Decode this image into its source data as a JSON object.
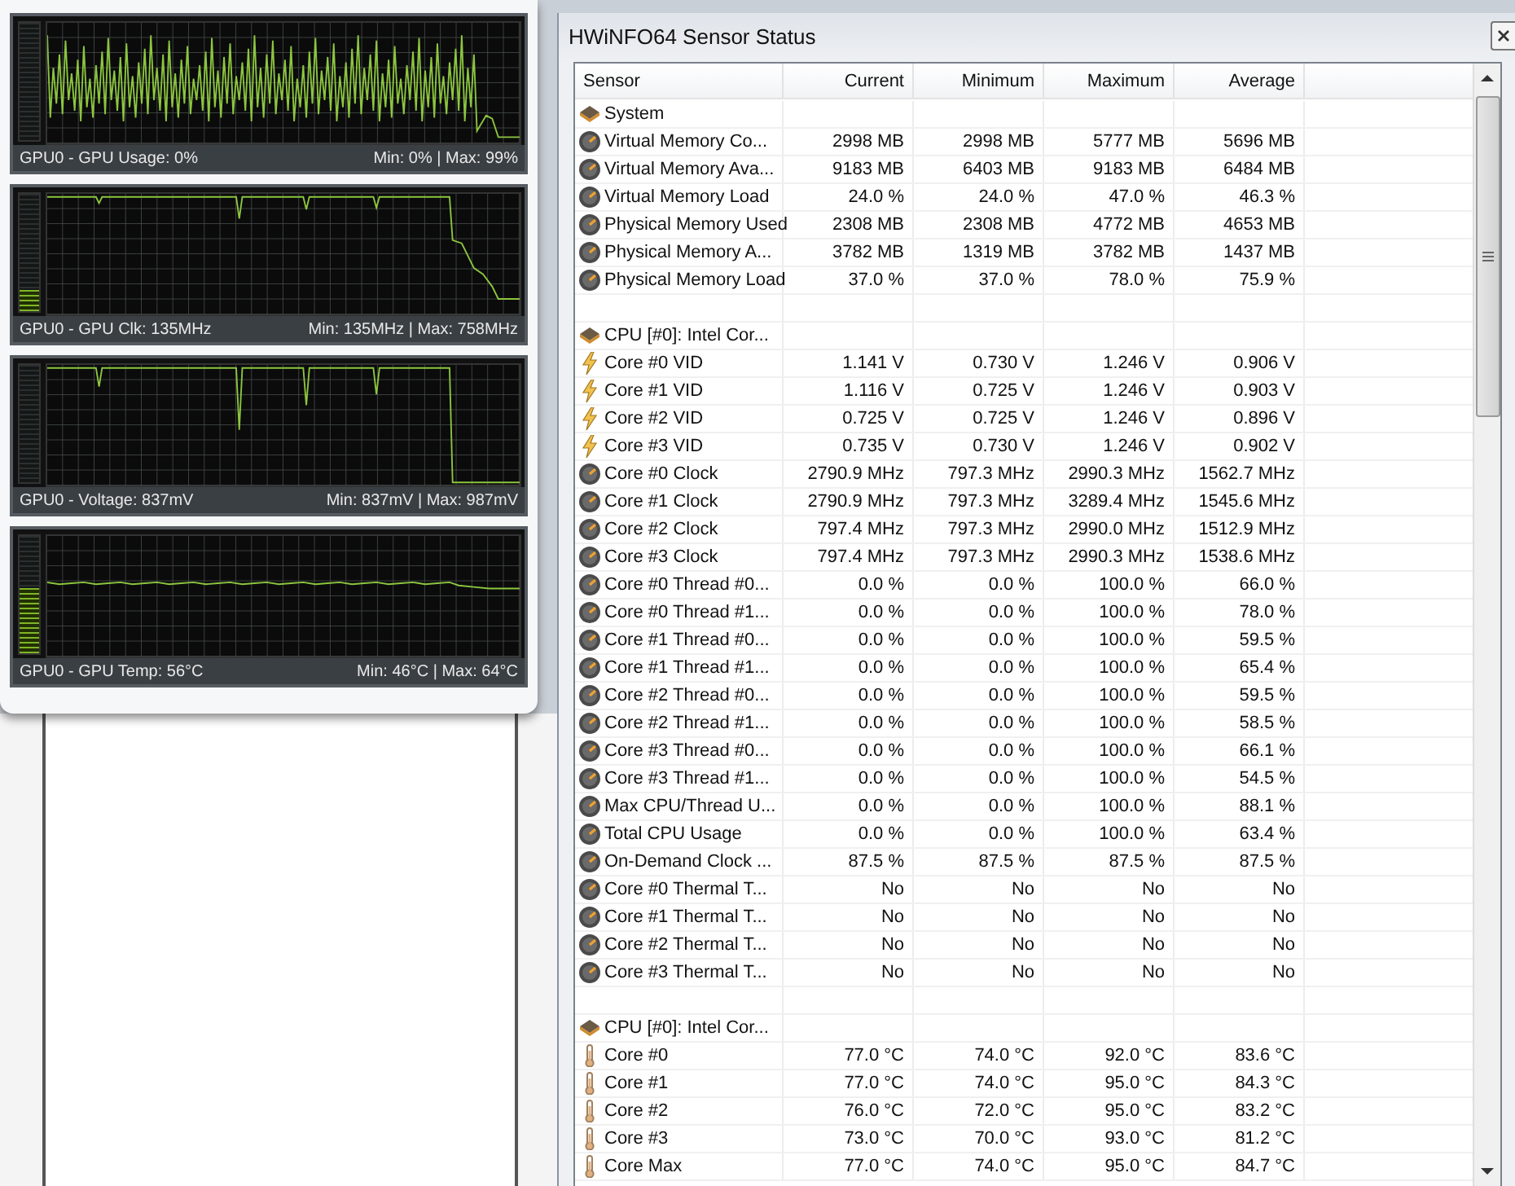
{
  "gadget": {
    "graphs": [
      {
        "kind": "usage",
        "level": 0,
        "label": "GPU0 - GPU Usage: 0%",
        "range": "Min: 0% | Max: 99%"
      },
      {
        "kind": "clock",
        "level": 0.18,
        "label": "GPU0 - GPU Clk: 135MHz",
        "range": "Min: 135MHz | Max: 758MHz"
      },
      {
        "kind": "voltage",
        "level": 0,
        "label": "GPU0 - Voltage: 837mV",
        "range": "Min: 837mV | Max: 987mV"
      },
      {
        "kind": "temp",
        "level": 0.55,
        "label": "GPU0 - GPU Temp: 56°C",
        "range": "Min: 46°C | Max: 64°C"
      }
    ]
  },
  "window": {
    "title": "HWiNFO64 Sensor Status"
  },
  "table": {
    "columns": [
      "Sensor",
      "Current",
      "Minimum",
      "Maximum",
      "Average"
    ],
    "rows": [
      {
        "kind": "group",
        "sensor": "System"
      },
      {
        "kind": "gauge",
        "sensor": "Virtual Memory Co...",
        "current": "2998 MB",
        "minimum": "2998 MB",
        "maximum": "5777 MB",
        "average": "5696 MB"
      },
      {
        "kind": "gauge",
        "sensor": "Virtual Memory Ava...",
        "current": "9183 MB",
        "minimum": "6403 MB",
        "maximum": "9183 MB",
        "average": "6484 MB"
      },
      {
        "kind": "gauge",
        "sensor": "Virtual Memory Load",
        "current": "24.0 %",
        "minimum": "24.0 %",
        "maximum": "47.0 %",
        "average": "46.3 %"
      },
      {
        "kind": "gauge",
        "sensor": "Physical Memory Used",
        "current": "2308 MB",
        "minimum": "2308 MB",
        "maximum": "4772 MB",
        "average": "4653 MB"
      },
      {
        "kind": "gauge",
        "sensor": "Physical Memory A...",
        "current": "3782 MB",
        "minimum": "1319 MB",
        "maximum": "3782 MB",
        "average": "1437 MB"
      },
      {
        "kind": "gauge",
        "sensor": "Physical Memory Load",
        "current": "37.0 %",
        "minimum": "37.0 %",
        "maximum": "78.0 %",
        "average": "75.9 %"
      },
      {
        "kind": "blank"
      },
      {
        "kind": "group",
        "sensor": "CPU [#0]: Intel Cor..."
      },
      {
        "kind": "voltage",
        "sensor": "Core #0 VID",
        "current": "1.141 V",
        "minimum": "0.730 V",
        "maximum": "1.246 V",
        "average": "0.906 V"
      },
      {
        "kind": "voltage",
        "sensor": "Core #1 VID",
        "current": "1.116 V",
        "minimum": "0.725 V",
        "maximum": "1.246 V",
        "average": "0.903 V"
      },
      {
        "kind": "voltage",
        "sensor": "Core #2 VID",
        "current": "0.725 V",
        "minimum": "0.725 V",
        "maximum": "1.246 V",
        "average": "0.896 V"
      },
      {
        "kind": "voltage",
        "sensor": "Core #3 VID",
        "current": "0.735 V",
        "minimum": "0.730 V",
        "maximum": "1.246 V",
        "average": "0.902 V"
      },
      {
        "kind": "gauge",
        "sensor": "Core #0 Clock",
        "current": "2790.9 MHz",
        "minimum": "797.3 MHz",
        "maximum": "2990.3 MHz",
        "average": "1562.7 MHz"
      },
      {
        "kind": "gauge",
        "sensor": "Core #1 Clock",
        "current": "2790.9 MHz",
        "minimum": "797.3 MHz",
        "maximum": "3289.4 MHz",
        "average": "1545.6 MHz"
      },
      {
        "kind": "gauge",
        "sensor": "Core #2 Clock",
        "current": "797.4 MHz",
        "minimum": "797.3 MHz",
        "maximum": "2990.0 MHz",
        "average": "1512.9 MHz"
      },
      {
        "kind": "gauge",
        "sensor": "Core #3 Clock",
        "current": "797.4 MHz",
        "minimum": "797.3 MHz",
        "maximum": "2990.3 MHz",
        "average": "1538.6 MHz"
      },
      {
        "kind": "gauge",
        "sensor": "Core #0 Thread #0...",
        "current": "0.0 %",
        "minimum": "0.0 %",
        "maximum": "100.0 %",
        "average": "66.0 %"
      },
      {
        "kind": "gauge",
        "sensor": "Core #0 Thread #1...",
        "current": "0.0 %",
        "minimum": "0.0 %",
        "maximum": "100.0 %",
        "average": "78.0 %"
      },
      {
        "kind": "gauge",
        "sensor": "Core #1 Thread #0...",
        "current": "0.0 %",
        "minimum": "0.0 %",
        "maximum": "100.0 %",
        "average": "59.5 %"
      },
      {
        "kind": "gauge",
        "sensor": "Core #1 Thread #1...",
        "current": "0.0 %",
        "minimum": "0.0 %",
        "maximum": "100.0 %",
        "average": "65.4 %"
      },
      {
        "kind": "gauge",
        "sensor": "Core #2 Thread #0...",
        "current": "0.0 %",
        "minimum": "0.0 %",
        "maximum": "100.0 %",
        "average": "59.5 %"
      },
      {
        "kind": "gauge",
        "sensor": "Core #2 Thread #1...",
        "current": "0.0 %",
        "minimum": "0.0 %",
        "maximum": "100.0 %",
        "average": "58.5 %"
      },
      {
        "kind": "gauge",
        "sensor": "Core #3 Thread #0...",
        "current": "0.0 %",
        "minimum": "0.0 %",
        "maximum": "100.0 %",
        "average": "66.1 %"
      },
      {
        "kind": "gauge",
        "sensor": "Core #3 Thread #1...",
        "current": "0.0 %",
        "minimum": "0.0 %",
        "maximum": "100.0 %",
        "average": "54.5 %"
      },
      {
        "kind": "gauge",
        "sensor": "Max CPU/Thread U...",
        "current": "0.0 %",
        "minimum": "0.0 %",
        "maximum": "100.0 %",
        "average": "88.1 %"
      },
      {
        "kind": "gauge",
        "sensor": "Total CPU Usage",
        "current": "0.0 %",
        "minimum": "0.0 %",
        "maximum": "100.0 %",
        "average": "63.4 %"
      },
      {
        "kind": "gauge",
        "sensor": "On-Demand Clock ...",
        "current": "87.5 %",
        "minimum": "87.5 %",
        "maximum": "87.5 %",
        "average": "87.5 %"
      },
      {
        "kind": "gauge",
        "sensor": "Core #0 Thermal T...",
        "current": "No",
        "minimum": "No",
        "maximum": "No",
        "average": "No"
      },
      {
        "kind": "gauge",
        "sensor": "Core #1 Thermal T...",
        "current": "No",
        "minimum": "No",
        "maximum": "No",
        "average": "No"
      },
      {
        "kind": "gauge",
        "sensor": "Core #2 Thermal T...",
        "current": "No",
        "minimum": "No",
        "maximum": "No",
        "average": "No"
      },
      {
        "kind": "gauge",
        "sensor": "Core #3 Thermal T...",
        "current": "No",
        "minimum": "No",
        "maximum": "No",
        "average": "No"
      },
      {
        "kind": "blank"
      },
      {
        "kind": "group",
        "sensor": "CPU [#0]: Intel Cor..."
      },
      {
        "kind": "temperature",
        "sensor": "Core #0",
        "current": "77.0 °C",
        "minimum": "74.0 °C",
        "maximum": "92.0 °C",
        "average": "83.6 °C"
      },
      {
        "kind": "temperature",
        "sensor": "Core #1",
        "current": "77.0 °C",
        "minimum": "74.0 °C",
        "maximum": "95.0 °C",
        "average": "84.3 °C"
      },
      {
        "kind": "temperature",
        "sensor": "Core #2",
        "current": "76.0 °C",
        "minimum": "72.0 °C",
        "maximum": "95.0 °C",
        "average": "83.2 °C"
      },
      {
        "kind": "temperature",
        "sensor": "Core #3",
        "current": "73.0 °C",
        "minimum": "70.0 °C",
        "maximum": "93.0 °C",
        "average": "81.2 °C"
      },
      {
        "kind": "temperature",
        "sensor": "Core Max",
        "current": "77.0 °C",
        "minimum": "74.0 °C",
        "maximum": "95.0 °C",
        "average": "84.7 °C"
      }
    ]
  }
}
